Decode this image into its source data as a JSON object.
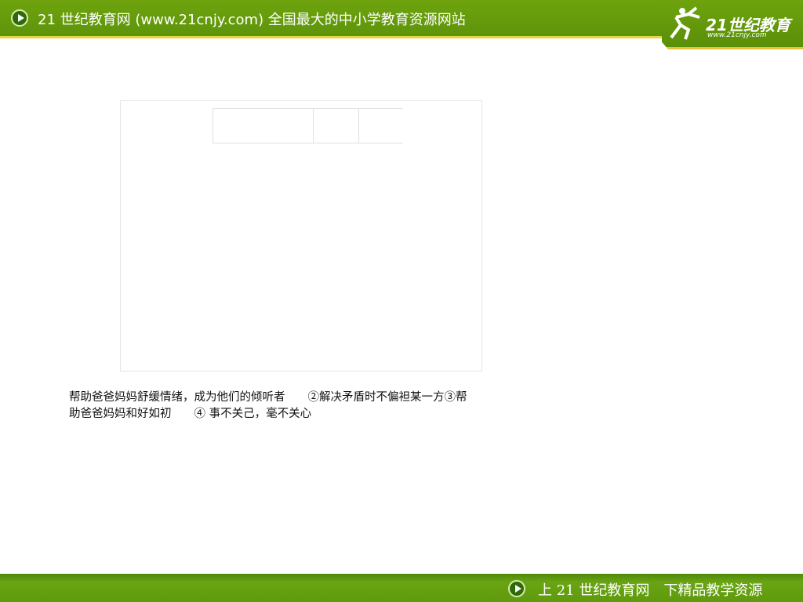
{
  "header": {
    "title": "21 世纪教育网 (www.21cnjy.com)  全国最大的中小学教育资源网站",
    "logo_text": "21世纪教育",
    "logo_url": "www.21cnjy.com"
  },
  "content": {
    "line1": "帮助爸爸妈妈舒缓情绪，成为他们的倾听者　　②解决矛盾时不偏袒某一方③帮",
    "line2": "助爸爸妈妈和好如初　　④ 事不关己，毫不关心"
  },
  "footer": {
    "text": "上 21 世纪教育网　下精品教学资源"
  }
}
